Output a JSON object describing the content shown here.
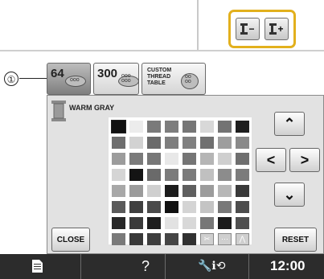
{
  "callout": {
    "number": "①"
  },
  "top": {
    "spool_minus_label": "−",
    "spool_plus_label": "+"
  },
  "tabs": [
    {
      "label": "64",
      "selected": true
    },
    {
      "label": "300",
      "selected": false
    },
    {
      "label": "CUSTOM\nTHREAD\nTABLE",
      "selected": false
    }
  ],
  "thread": {
    "name": "WARM GRAY"
  },
  "palette": {
    "rows": [
      [
        "#111111",
        "#ececec",
        "#7a7a7a",
        "#7d7d7d",
        "#767676",
        "#d8d8d8",
        "#737373",
        "#1e1e1e"
      ],
      [
        "#6e6e6e",
        "#d2d2d2",
        "#6a6a6a",
        "#7e7e7e",
        "#808080",
        "#707070",
        "#9e9e9e",
        "#8a8a8a"
      ],
      [
        "#9c9c9c",
        "#7a7a7a",
        "#777777",
        "#e8e8e8",
        "#757575",
        "#b5b5b5",
        "#cfcfcf",
        "#6f6f6f"
      ],
      [
        "#d5d5d5",
        "#141414",
        "#6a6a6a",
        "#7b7b7b",
        "#7b7b7b",
        "#c0c0c0",
        "#8c8c8c",
        "#7c7c7c"
      ],
      [
        "#a8a8a8",
        "#9b9b9b",
        "#cfcfcf",
        "#1c1c1c",
        "#5f5f5f",
        "#9c9c9c",
        "#b7b7b7",
        "#3a3a3a"
      ],
      [
        "#5a5a5a",
        "#3f3f3f",
        "#4b4b4b",
        "#111111",
        "#d4d4d4",
        "#c4c4c4",
        "#787878",
        "#4d4d4d"
      ],
      [
        "#272727",
        "#3a3a3a",
        "#1d1d1d",
        "#e2e2e2",
        "#d8d8d8",
        "#777777",
        "#1a1a1a",
        "#4f4f4f"
      ],
      [
        "#7a7a7a",
        "#393939",
        "#3e3e3e",
        "#454545",
        "#313131",
        "#8a8a8a",
        "#d0d0d0",
        "#c0c0c0"
      ]
    ],
    "special_cells": [
      "scissors",
      "dashes",
      "zigzag"
    ]
  },
  "buttons": {
    "close": "CLOSE",
    "reset": "RESET"
  },
  "status_bar": {
    "help": "?",
    "time": "12:00"
  },
  "colors": {
    "highlight": "#e2b01d",
    "status_bar": "#2c2c2c"
  }
}
